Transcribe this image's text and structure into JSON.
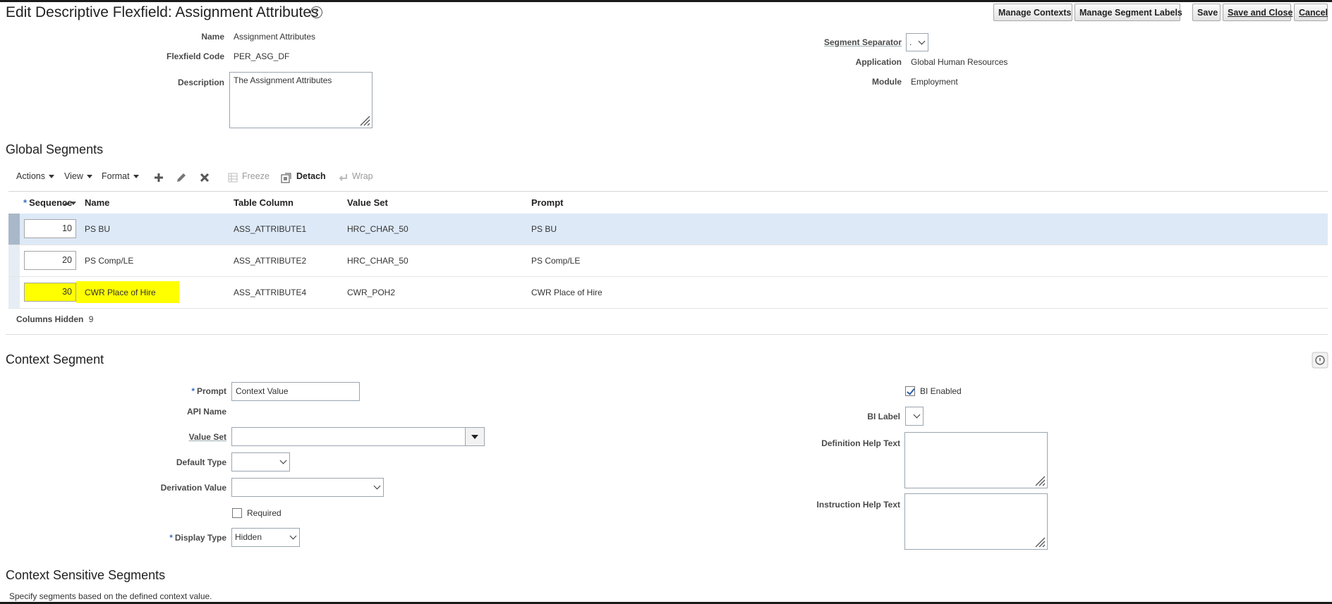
{
  "page": {
    "title": "Edit Descriptive Flexfield: Assignment Attributes",
    "help_icon": "question-circle-icon",
    "buttons": {
      "manage_contexts": "Manage Contexts",
      "manage_segment_labels": "Manage Segment Labels",
      "save": "Save",
      "save_and_close": "Save and Close",
      "cancel": "Cancel"
    }
  },
  "header_form": {
    "name_label": "Name",
    "name_value": "Assignment Attributes",
    "code_label": "Flexfield Code",
    "code_value": "PER_ASG_DF",
    "description_label": "Description",
    "description_value": "The Assignment Attributes",
    "segment_separator_label": "Segment Separator",
    "segment_separator_value": ".",
    "application_label": "Application",
    "application_value": "Global Human Resources",
    "module_label": "Module",
    "module_value": "Employment"
  },
  "global_segments": {
    "heading": "Global Segments",
    "toolbar": {
      "actions": "Actions",
      "view": "View",
      "format": "Format",
      "freeze": "Freeze",
      "detach": "Detach",
      "wrap": "Wrap"
    },
    "columns": {
      "sequence": "Sequence",
      "name": "Name",
      "table_column": "Table Column",
      "value_set": "Value Set",
      "prompt": "Prompt"
    },
    "rows": [
      {
        "sequence": "10",
        "name": "PS BU",
        "table_column": "ASS_ATTRIBUTE1",
        "value_set": "HRC_CHAR_50",
        "prompt": "PS BU"
      },
      {
        "sequence": "20",
        "name": "PS Comp/LE",
        "table_column": "ASS_ATTRIBUTE2",
        "value_set": "HRC_CHAR_50",
        "prompt": "PS Comp/LE"
      },
      {
        "sequence": "30",
        "name": "CWR Place of Hire",
        "table_column": "ASS_ATTRIBUTE4",
        "value_set": "CWR_POH2",
        "prompt": "CWR Place of Hire"
      }
    ],
    "columns_hidden_label": "Columns Hidden",
    "columns_hidden_count": "9",
    "highlight_color": "#ffff00",
    "selected_row_color": "#dde9f7"
  },
  "context_segment": {
    "heading": "Context Segment",
    "prompt_label": "Prompt",
    "prompt_value": "Context Value",
    "api_name_label": "API Name",
    "value_set_label": "Value Set",
    "value_set_value": "",
    "default_type_label": "Default Type",
    "default_type_value": "",
    "derivation_value_label": "Derivation Value",
    "derivation_value_value": "",
    "required_label": "Required",
    "required_checked": false,
    "display_type_label": "Display Type",
    "display_type_value": "Hidden",
    "bi_enabled_label": "BI Enabled",
    "bi_enabled_checked": true,
    "bi_label_label": "BI Label",
    "definition_help_label": "Definition Help Text",
    "instruction_help_label": "Instruction Help Text"
  },
  "context_sensitive": {
    "heading": "Context Sensitive Segments",
    "description": "Specify segments based on the defined context value."
  }
}
